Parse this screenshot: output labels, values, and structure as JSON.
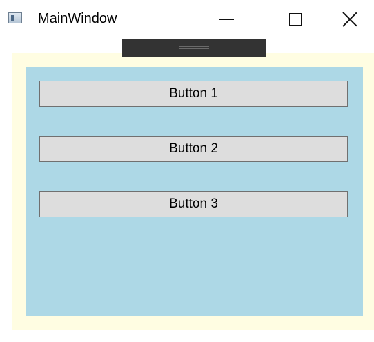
{
  "window": {
    "title": "MainWindow",
    "icon": "app-window-icon",
    "caption_buttons": [
      "minimize-icon",
      "maximize-icon",
      "close-icon"
    ]
  },
  "colors": {
    "client_background": "#fffde2",
    "panel_background": "#add8e6",
    "button_background": "#dddddd",
    "button_border": "#707070",
    "grip_background": "#333333"
  },
  "panel": {
    "buttons": [
      {
        "label": "Button 1"
      },
      {
        "label": "Button 2"
      },
      {
        "label": "Button 3"
      }
    ]
  }
}
